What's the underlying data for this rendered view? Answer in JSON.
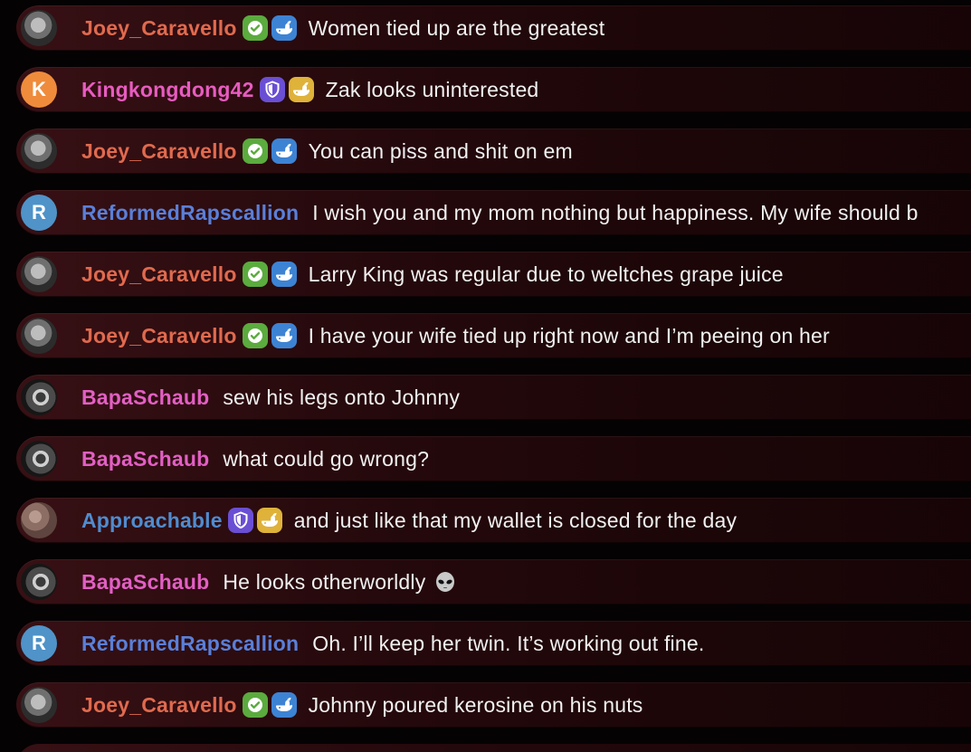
{
  "colors": {
    "joey": "#e06a4e",
    "kingkong": "#e85bc0",
    "reformed": "#5a7fd8",
    "bapa": "#e25fc4",
    "approachable": "#4f8ccf"
  },
  "messages": [
    {
      "user": "Joey_Caravello",
      "avatar": "photo-joey",
      "badges": [
        "verified-icon",
        "whale-blue-icon"
      ],
      "text": "Women tied up are the greatest"
    },
    {
      "user": "Kingkongdong42",
      "avatar": "K",
      "badges": [
        "moderator-shield-icon",
        "whale-gold-icon"
      ],
      "text": "Zak looks uninterested"
    },
    {
      "user": "Joey_Caravello",
      "avatar": "photo-joey",
      "badges": [
        "verified-icon",
        "whale-blue-icon"
      ],
      "text": "You can piss and shit on em"
    },
    {
      "user": "ReformedRapscallion",
      "avatar": "R",
      "badges": [],
      "text": "I wish you and my mom nothing but happiness. My wife should b"
    },
    {
      "user": "Joey_Caravello",
      "avatar": "photo-joey",
      "badges": [
        "verified-icon",
        "whale-blue-icon"
      ],
      "text": "Larry King was regular due to weltches grape juice"
    },
    {
      "user": "Joey_Caravello",
      "avatar": "photo-joey",
      "badges": [
        "verified-icon",
        "whale-blue-icon"
      ],
      "text": "I have your wife tied up right now and I’m peeing on her"
    },
    {
      "user": "BapaSchaub",
      "avatar": "photo-bapa",
      "badges": [],
      "text": "sew his legs onto Johnny"
    },
    {
      "user": "BapaSchaub",
      "avatar": "photo-bapa",
      "badges": [],
      "text": "what could go wrong?"
    },
    {
      "user": "Approachable",
      "avatar": "photo-approach",
      "badges": [
        "moderator-shield-icon",
        "whale-gold-icon"
      ],
      "text": "and just like that my wallet is closed for the day"
    },
    {
      "user": "BapaSchaub",
      "avatar": "photo-bapa",
      "badges": [],
      "text": "He looks otherworldly",
      "emoji": "alien-emoji-icon"
    },
    {
      "user": "ReformedRapscallion",
      "avatar": "R",
      "badges": [],
      "text": "Oh. I’ll keep her twin. It’s working out fine."
    },
    {
      "user": "Joey_Caravello",
      "avatar": "photo-joey",
      "badges": [
        "verified-icon",
        "whale-blue-icon"
      ],
      "text": "Johnny poured kerosine on his nuts"
    }
  ]
}
